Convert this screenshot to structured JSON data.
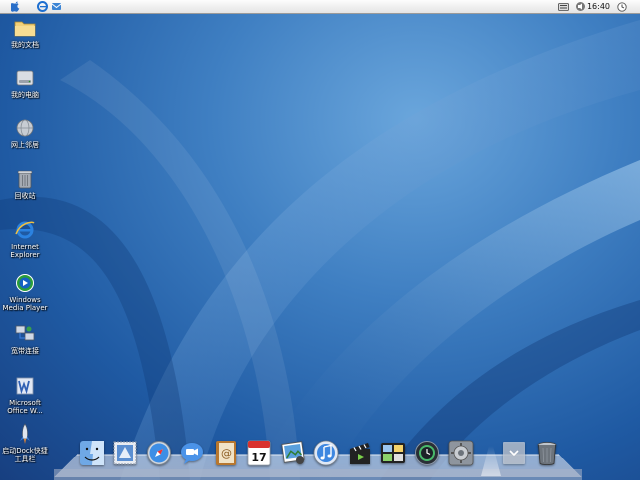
{
  "menubar": {
    "clock": "16:40",
    "left_icons": [
      "apple-logo-icon",
      "internet-explorer-icon",
      "outlook-express-icon"
    ],
    "right_icons": [
      "keyboard-icon",
      "speaker-icon",
      "clock-icon"
    ]
  },
  "desktop_icons": [
    {
      "name": "my-documents",
      "label": "我的文档",
      "icon": "folder-icon"
    },
    {
      "name": "my-computer",
      "label": "我的电脑",
      "icon": "hard-drive-icon"
    },
    {
      "name": "network-places",
      "label": "网上邻居",
      "icon": "network-globe-icon"
    },
    {
      "name": "recycle-bin",
      "label": "回收站",
      "icon": "trash-icon"
    },
    {
      "name": "internet-explorer",
      "label": "Internet Explorer",
      "icon": "internet-explorer-icon"
    },
    {
      "name": "windows-media-player",
      "label": "Windows Media Player",
      "icon": "media-player-icon"
    },
    {
      "name": "broadband-connection",
      "label": "宽带连接",
      "icon": "network-connection-icon"
    },
    {
      "name": "microsoft-office-word",
      "label": "Microsoft Office W...",
      "icon": "word-icon"
    },
    {
      "name": "rocketdock-shortcut",
      "label": "启动Dock快捷工具栏",
      "icon": "rocket-icon"
    }
  ],
  "dock": {
    "items": [
      {
        "name": "finder",
        "icon": "finder-icon"
      },
      {
        "name": "mail",
        "icon": "mail-stamp-icon"
      },
      {
        "name": "safari",
        "icon": "safari-compass-icon"
      },
      {
        "name": "ichat",
        "icon": "video-chat-icon"
      },
      {
        "name": "address-book",
        "icon": "address-book-icon"
      },
      {
        "name": "ical",
        "icon": "calendar-icon",
        "text": "17"
      },
      {
        "name": "iphoto",
        "icon": "photos-icon"
      },
      {
        "name": "itunes",
        "icon": "music-note-icon"
      },
      {
        "name": "imovie",
        "icon": "clapperboard-icon"
      },
      {
        "name": "dashboard",
        "icon": "dashboard-icon"
      },
      {
        "name": "time-machine",
        "icon": "time-machine-icon"
      },
      {
        "name": "system-preferences",
        "icon": "gear-icon"
      },
      {
        "name": "downloads-stack",
        "icon": "downloads-stack-icon"
      },
      {
        "name": "trash",
        "icon": "trash-can-icon"
      }
    ]
  },
  "colors": {
    "wallpaper_dark": "#173f80",
    "wallpaper_light": "#6aa6dc",
    "menubar": "#ececec"
  }
}
